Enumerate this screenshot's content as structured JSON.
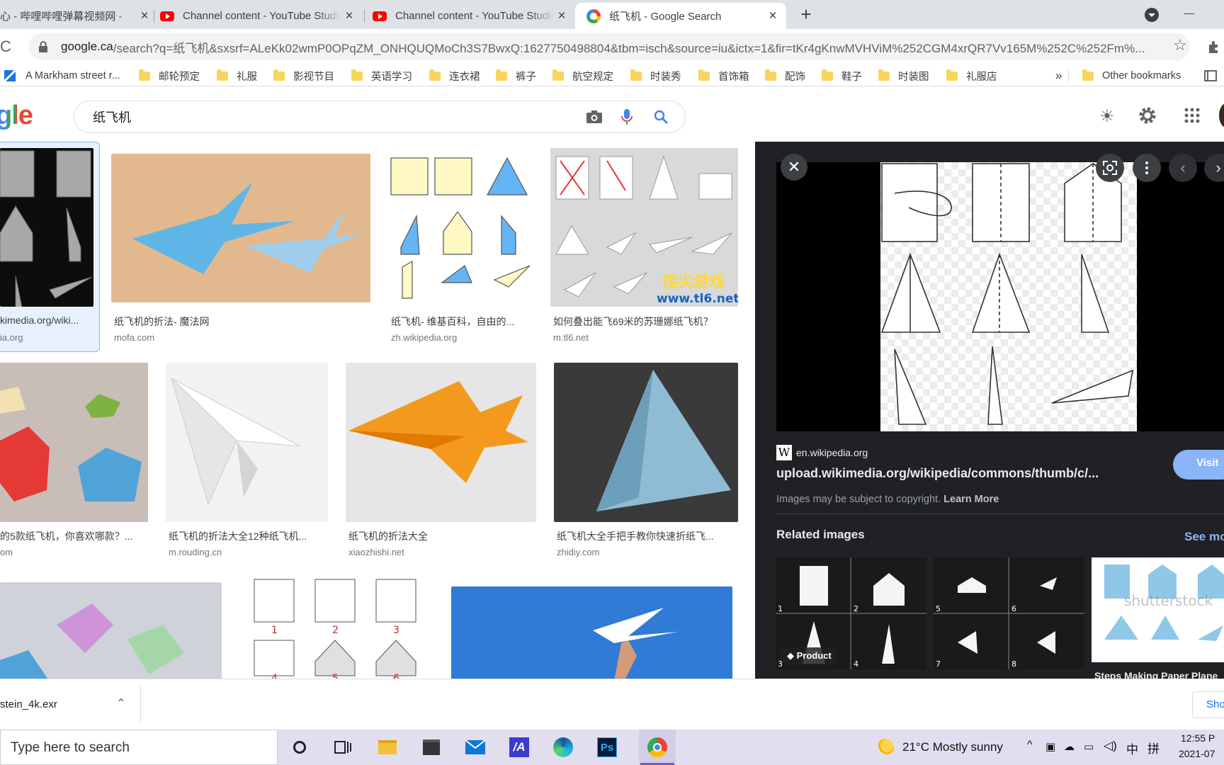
{
  "tabs": [
    {
      "title": "心 - 哔哩哔哩弹幕视频网 - ",
      "icon": "bilibili-icon"
    },
    {
      "title": "Channel content - YouTube Studio",
      "icon": "youtube-icon"
    },
    {
      "title": "Channel content - YouTube Studio",
      "icon": "youtube-icon"
    },
    {
      "title": "纸飞机 - Google Search",
      "icon": "google-icon",
      "active": true
    }
  ],
  "omnibox": {
    "host": "google.ca",
    "path": "/search?q=纸飞机&sxsrf=ALeKk02wmP0OPqZM_ONHQUQMoCh3S7BwxQ:1627750498804&tbm=isch&source=iu&ictx=1&fir=tKr4gKnwMVHViM%252CGM4xrQR7Vv165M%252C%252Fm%..."
  },
  "bookmarks": {
    "items": [
      "A Markham street r...",
      "邮轮预定",
      "礼服",
      "影视节目",
      "英语学习",
      "连衣裙",
      "裤子",
      "航空规定",
      "时装秀",
      "首饰箱",
      "配饰",
      "鞋子",
      "时装图",
      "礼服店"
    ],
    "overflow": "»",
    "other": "Other bookmarks"
  },
  "search": {
    "logo_visible": "gle",
    "query": "纸飞机"
  },
  "results": [
    {
      "caption": "kimedia.org/wiki...",
      "source": "ia.org"
    },
    {
      "caption": "纸飞机的折法- 魔法网",
      "source": "mofa.com"
    },
    {
      "caption": "纸飞机- 维基百科，自由的...",
      "source": "zh.wikipedia.org"
    },
    {
      "caption": "如何叠出能飞69米的苏珊娜纸飞机？",
      "source": "m.tl6.net"
    },
    {
      "caption": "的5款纸飞机，你喜欢哪款？...",
      "source": "om"
    },
    {
      "caption": "纸飞机的折法大全12种纸飞机...",
      "source": "m.rouding.cn"
    },
    {
      "caption": "纸飞机的折法大全",
      "source": "xiaozhishi.net"
    },
    {
      "caption": "纸飞机大全手把手教你快速折纸飞...",
      "source": "zhidiy.com"
    }
  ],
  "grid_text": {
    "tl6_watermark": "指尖游戏",
    "tl6_url": "www.tl6.net",
    "fold_numbers": [
      "1",
      "2",
      "3",
      "4",
      "5",
      "6"
    ]
  },
  "panel": {
    "site": "en.wikipedia.org",
    "url": "upload.wikimedia.org/wikipedia/commons/thumb/c/...",
    "visit": "Visit",
    "copyright": "Images may be subject to copyright.",
    "learn_more": "Learn More",
    "related_title": "Related images",
    "see_more": "See mo",
    "related_nums_a": [
      "1",
      "2",
      "3",
      "4"
    ],
    "related_nums_b": [
      "5",
      "6",
      "7",
      "8"
    ],
    "product_badge": "Product",
    "shutterstock": "shutterstock",
    "related_caption": "Steps Making Paper Plane"
  },
  "download": {
    "filename": "stein_4k.exr",
    "show_all": "Sho"
  },
  "taskbar": {
    "search_placeholder": "Type here to search",
    "weather": "21°C  Mostly sunny",
    "ime": "中",
    "time": "12:55 P",
    "date": "2021-07"
  }
}
